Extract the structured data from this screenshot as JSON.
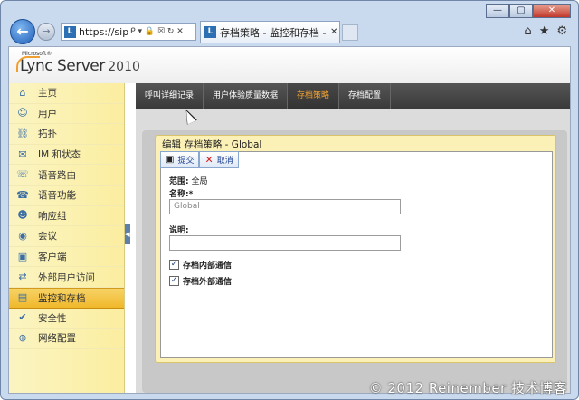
{
  "window": {
    "min": "—",
    "max": "▢",
    "close": "✕"
  },
  "browser": {
    "address": "https://sip.c...",
    "address_icons": "ᑭ ▾ 🔒 ☒ ↻ ✕",
    "favicon": "L",
    "tab_title": "存档策略 - 监控和存档 - M...",
    "tab_close": "✕",
    "tools": [
      "⌂",
      "★",
      "⚙"
    ],
    "back": "←",
    "forward": "→"
  },
  "app": {
    "ms": "Microsoft®",
    "product": "Lync Server",
    "year": "2010"
  },
  "sidebar": {
    "items": [
      {
        "icon": "⌂",
        "label": "主页"
      },
      {
        "icon": "☺",
        "label": "用户"
      },
      {
        "icon": "⛓",
        "label": "拓扑"
      },
      {
        "icon": "✉",
        "label": "IM 和状态"
      },
      {
        "icon": "☏",
        "label": "语音路由"
      },
      {
        "icon": "☎",
        "label": "语音功能"
      },
      {
        "icon": "☻",
        "label": "响应组"
      },
      {
        "icon": "◉",
        "label": "会议"
      },
      {
        "icon": "▣",
        "label": "客户端"
      },
      {
        "icon": "⇄",
        "label": "外部用户访问"
      },
      {
        "icon": "▤",
        "label": "监控和存档"
      },
      {
        "icon": "✔",
        "label": "安全性"
      },
      {
        "icon": "⊕",
        "label": "网络配置"
      }
    ]
  },
  "topnav": {
    "items": [
      "呼叫详细记录",
      "用户体验质量数据",
      "存档策略",
      "存档配置"
    ]
  },
  "form": {
    "title": "编辑 存档策略 - Global",
    "commit": "提交",
    "cancel": "取消",
    "scope_label": "范围:",
    "scope_value": "全局",
    "name_label": "名称:*",
    "name_value": "Global",
    "desc_label": "说明:",
    "desc_value": "",
    "chk_internal": "存档内部通信",
    "chk_external": "存档外部通信",
    "check_mark": "✓"
  },
  "watermark": "© 2012 Reinember 技术博客",
  "colors": {
    "accent": "#f0a030",
    "active_nav": "#f0b82b",
    "sidebar_bg": "#fbeea0"
  }
}
